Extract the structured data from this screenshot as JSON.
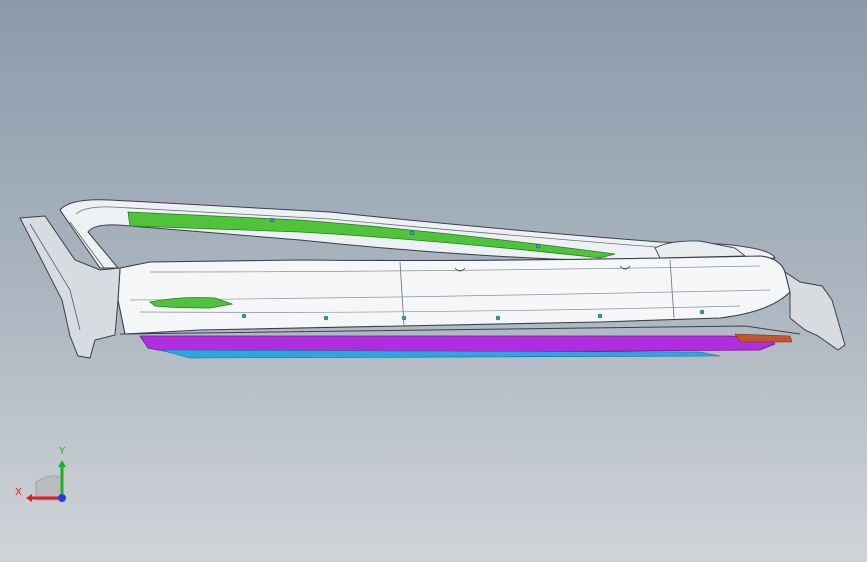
{
  "viewport": {
    "background_top": "#8b9aab",
    "background_bottom": "#d0d4d8"
  },
  "model": {
    "body_color": "#f4f6f8",
    "edge_color": "#3a3f47",
    "seal_color": "#4fc43a",
    "skirt_color": "#b02ee0",
    "skirt_under_color": "#2aa7e0",
    "trim_color": "#c0562b"
  },
  "triad": {
    "x_label": "X",
    "y_label": "Y",
    "x_color": "#e02020",
    "y_color": "#20b020",
    "z_color": "#2040e0"
  }
}
